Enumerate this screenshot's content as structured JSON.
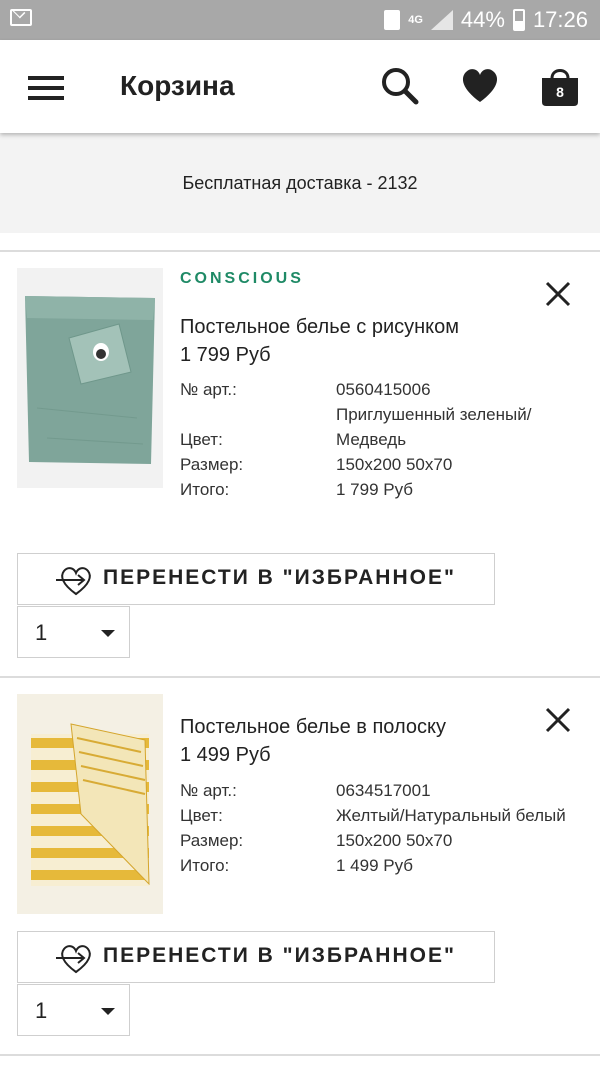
{
  "status_bar": {
    "network": "4G",
    "battery": "44%",
    "time": "17:26"
  },
  "header": {
    "title": "Корзина",
    "bag_count": "8",
    "icons": [
      "menu-icon",
      "search-icon",
      "heart-icon",
      "bag-icon"
    ]
  },
  "promo": {
    "text": "Бесплатная доставка  - 2132"
  },
  "labels": {
    "art": "№ арт.:",
    "color": "Цвет:",
    "size": "Размер:",
    "total": "Итого:",
    "move_to_favorites": "ПЕРЕНЕСТИ В \"ИЗБРАННОЕ\""
  },
  "items": [
    {
      "tag": "CONSCIOUS",
      "name": "Постельное белье с рисунком",
      "price": "1 799 Руб",
      "art": "0560415006",
      "color_line1": "Приглушенный зеленый/",
      "color_line2": "Медведь",
      "size": "150x200 50x70",
      "total": "1 799 Руб",
      "quantity": "1"
    },
    {
      "tag": "",
      "name": "Постельное белье в полоску",
      "price": "1 499 Руб",
      "art": "0634517001",
      "color": "Желтый/Натуральный белый",
      "size": "150x200 50x70",
      "total": "1 499 Руб",
      "quantity": "1"
    }
  ],
  "colors": {
    "accent_green": "#1f8a66",
    "status_bar": "#a8a8a8",
    "promo_bg": "#f3f3f3"
  }
}
